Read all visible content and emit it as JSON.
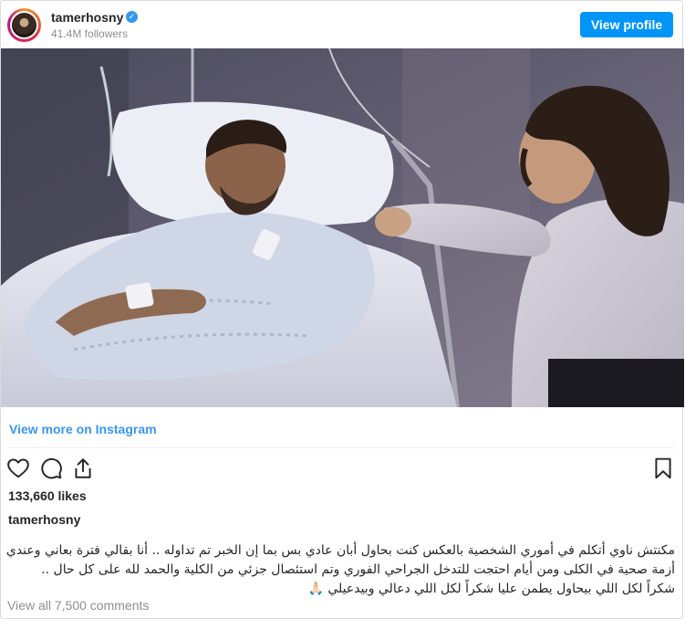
{
  "header": {
    "username": "tamerhosny",
    "verified": true,
    "followers": "41.4M followers",
    "view_profile_label": "View profile"
  },
  "media": {
    "icon": "photo"
  },
  "links": {
    "view_more": "View more on Instagram",
    "view_comments": "View all 7,500 comments"
  },
  "actions": {
    "icons": [
      "heart-icon",
      "comment-icon",
      "share-icon",
      "bookmark-icon"
    ]
  },
  "post": {
    "likes": "133,660 likes",
    "caption_user": "tamerhosny",
    "caption_lines": [
      "مكنتش ناوي أتكلم في أموري الشخصية بالعكس كنت بحاول أبان عادي بس بما إن الخبر تم تداوله .. أنا بقالي فترة بعاني وعندي",
      "أزمة صحية في الكلى ومن أيام احتجت للتدخل الجراحي الفوري وتم استئصال جزئي من الكلية والحمد لله على كل حال ..",
      "شكراً لكل اللي بيحاول يطمن عليا شكراً لكل اللي دعالي وبيدعيلي 🙏🏻"
    ]
  },
  "colors": {
    "accent": "#0095f6",
    "link": "#3897f0",
    "muted": "#8e8e8e",
    "text": "#262626"
  }
}
